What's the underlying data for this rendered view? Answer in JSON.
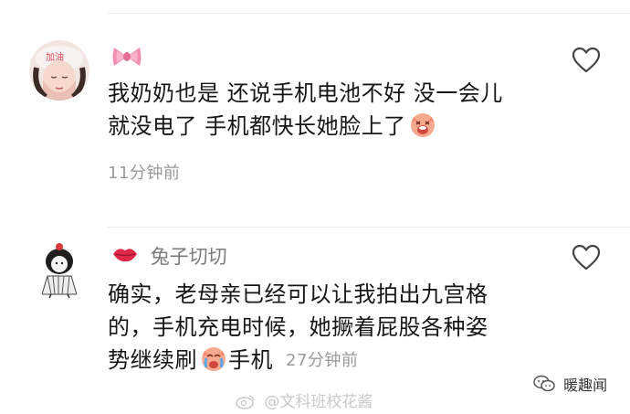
{
  "comments": [
    {
      "username": "",
      "username_emoji": "bow-emoji",
      "lines": [
        "我奶奶也是 还说手机电池不好 没一会儿",
        "就没电了 手机都快长她脸上了"
      ],
      "inline_emoji": "pig-laugh-emoji",
      "timestamp": "11分钟前",
      "liked": false
    },
    {
      "username": "兔子切切",
      "username_emoji": "lips-emoji",
      "lines": [
        "确实，老母亲已经可以让我拍出九宫格",
        "的，手机充电时候，她撅着屁股各种姿",
        "势继续刷"
      ],
      "inline_emoji": "crying-laugh-emoji",
      "tail_text": "手机",
      "timestamp": "27分钟前",
      "liked": false
    }
  ],
  "watermarks": {
    "weibo": "@文科班校花酱",
    "channel": "暖趣闻"
  },
  "colors": {
    "text": "#161616",
    "meta": "#9a9a9a",
    "username": "#7a7a7a",
    "divider": "#ececec",
    "heart_outline": "#444444"
  }
}
